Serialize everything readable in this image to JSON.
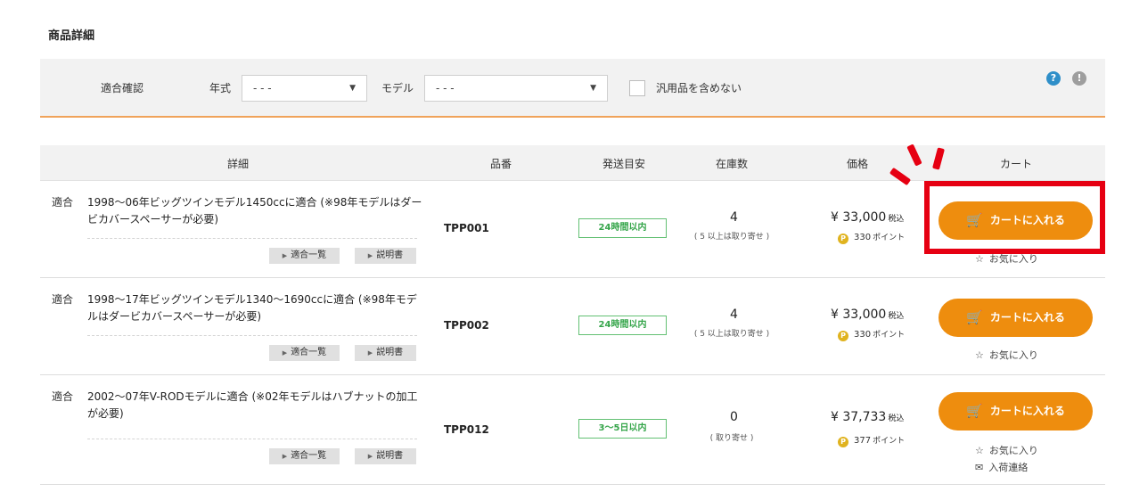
{
  "section_title": "商品詳細",
  "filter": {
    "fit_label": "適合確認",
    "year_label": "年式",
    "year_value": "- - -",
    "model_label": "モデル",
    "model_value": "- - -",
    "exclude_label": "汎用品を含めない"
  },
  "headers": {
    "detail": "詳細",
    "part_no": "品番",
    "shipping": "発送目安",
    "stock": "在庫数",
    "price": "価格",
    "cart": "カート"
  },
  "labels": {
    "fit": "適合",
    "fit_list": "適合一覧",
    "manual": "説明書",
    "add_to_cart": "カートに入れる",
    "tax": "税込",
    "point_unit": "ポイント",
    "favorite": "お気に入り",
    "notify": "入荷連絡",
    "point_icon": "P"
  },
  "rows": [
    {
      "description": "1998～06年ビッグツインモデル1450ccに適合 (※98年モデルはダービカバースペーサーが必要)",
      "part_no": "TPP001",
      "shipping": "24時間以内",
      "stock": "4",
      "stock_note": "( 5 以上は取り寄せ )",
      "price": "¥ 33,000",
      "points": "330"
    },
    {
      "description": "1998～17年ビッグツインモデル1340～1690ccに適合 (※98年モデルはダービカバースペーサーが必要)",
      "part_no": "TPP002",
      "shipping": "24時間以内",
      "stock": "4",
      "stock_note": "( 5 以上は取り寄せ )",
      "price": "¥ 33,000",
      "points": "330"
    },
    {
      "description": "2002～07年V-RODモデルに適合 (※02年モデルはハブナットの加工が必要)",
      "part_no": "TPP012",
      "shipping": "3～5日以内",
      "stock": "0",
      "stock_note": "( 取り寄せ )",
      "price": "¥ 37,733",
      "points": "377"
    }
  ],
  "colors": {
    "accent_orange": "#ee8d0e",
    "badge_green": "#35a54a",
    "highlight_red": "#e60012"
  },
  "icons": {
    "help": "question-circle-icon",
    "info": "exclamation-circle-icon",
    "cart": "shopping-cart-icon",
    "star": "star-outline-icon",
    "mail": "envelope-icon"
  }
}
